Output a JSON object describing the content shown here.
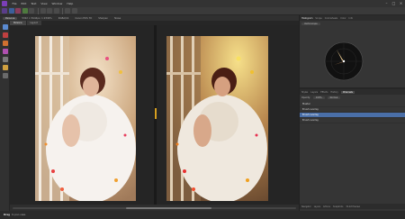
{
  "menu": {
    "items": [
      "File",
      "Edit",
      "Text",
      "View",
      "Window",
      "Help"
    ]
  },
  "context": {
    "chip": "Persona",
    "items": [
      "5322 × 8144px, 1:2349%",
      "RGBA/16",
      "Canon EOS 7D",
      "Sharpen",
      "Noise"
    ]
  },
  "doc_tabs": [
    "Persona",
    "Layout"
  ],
  "right_panel": {
    "tabs": [
      "Histogram",
      "Scope",
      "Colorwheels",
      "Color",
      "Info"
    ],
    "scope_label": "Vectorscope",
    "scope_mode": "Vectorscope"
  },
  "layers": {
    "tabs": [
      "Styles",
      "Layers",
      "Effects",
      "History",
      "Channels"
    ],
    "opacity_label": "Opacity:",
    "opacity_value": "100%",
    "blend_label": "Normal",
    "rows": [
      "Master",
      "Brush overlay",
      "Brush overlay",
      "Brush overlay"
    ],
    "selected_index": 2,
    "bottom": [
      "Navigator",
      "Layers",
      "Actions",
      "Snapshots",
      "32-bit Preview"
    ]
  },
  "status": {
    "bold": "Drag",
    "text": "to pan view."
  },
  "colors": {
    "accent_selected": "#4a6fa8",
    "divider_handle": "#d8a020"
  }
}
